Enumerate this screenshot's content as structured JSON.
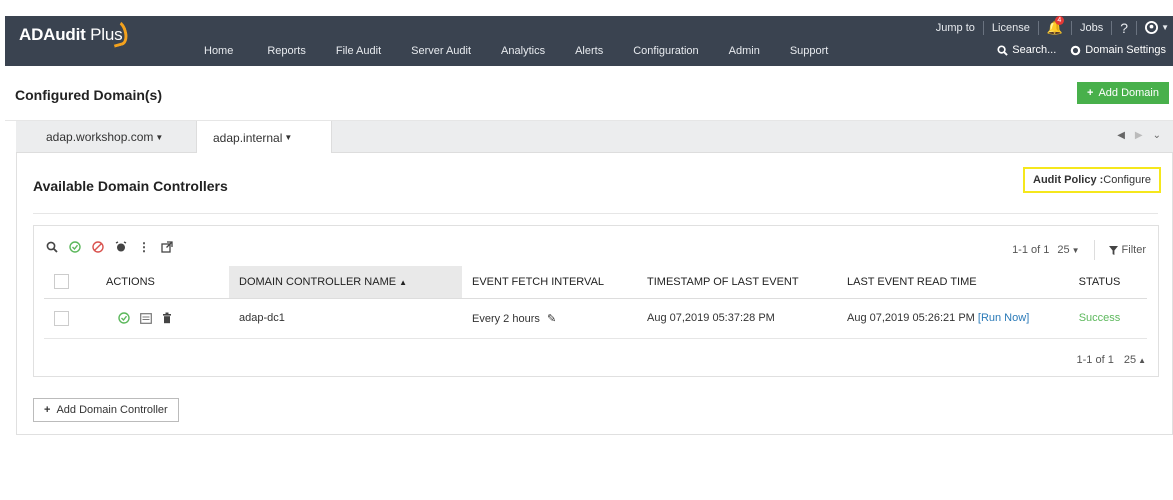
{
  "app": {
    "logo_bold": "ADAudit",
    "logo_light": "Plus"
  },
  "nav": {
    "items": [
      "Home",
      "Reports",
      "File Audit",
      "Server Audit",
      "Analytics",
      "Alerts",
      "Configuration",
      "Admin",
      "Support"
    ]
  },
  "utility": {
    "jump_to": "Jump to",
    "license": "License",
    "notification_count": "4",
    "jobs": "Jobs",
    "help": "?",
    "search": "Search...",
    "domain_settings": "Domain Settings"
  },
  "page": {
    "title": "Configured Domain(s)",
    "add_domain": "Add Domain"
  },
  "tabs": [
    {
      "label": "adap.workshop.com"
    },
    {
      "label": "adap.internal"
    }
  ],
  "panel": {
    "title": "Available Domain Controllers",
    "audit_policy_label": "Audit Policy :",
    "audit_policy_value": "Configure"
  },
  "grid": {
    "pager": "1-1 of 1",
    "page_size": "25",
    "filter": "Filter",
    "columns": [
      "ACTIONS",
      "DOMAIN CONTROLLER NAME",
      "EVENT FETCH INTERVAL",
      "TIMESTAMP OF LAST EVENT",
      "LAST EVENT READ TIME",
      "STATUS"
    ],
    "rows": [
      {
        "name": "adap-dc1",
        "interval": "Every 2 hours",
        "timestamp": "Aug 07,2019 05:37:28 PM",
        "last_read": "Aug 07,2019 05:26:21 PM",
        "run_now": "[Run Now]",
        "status": "Success"
      }
    ]
  },
  "add_dc": "Add Domain Controller",
  "colors": {
    "nav_bg": "#3a4350",
    "accent_green": "#48b04b",
    "highlight_yellow": "#f5e71c",
    "link_blue": "#2a7ab8"
  }
}
